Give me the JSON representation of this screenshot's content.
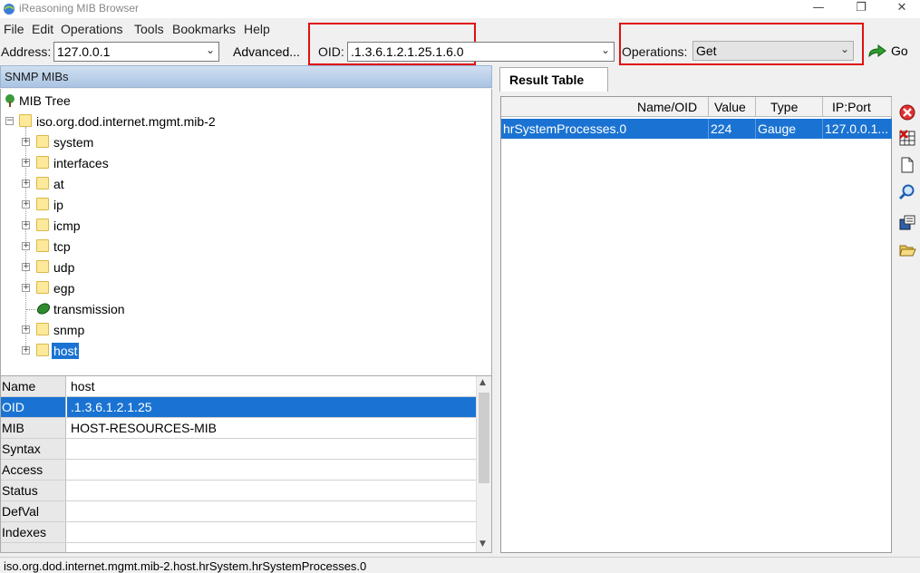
{
  "window": {
    "title": "iReasoning MIB Browser",
    "minimize": "—",
    "restore": "❐",
    "close": "✕"
  },
  "menu": [
    "File",
    "Edit",
    "Operations",
    "Tools",
    "Bookmarks",
    "Help"
  ],
  "toolbar": {
    "address_label": "Address:",
    "address_value": "127.0.0.1",
    "advanced_label": "Advanced...",
    "oid_label": "OID:",
    "oid_value": ".1.3.6.1.2.1.25.1.6.0",
    "operations_label": "Operations:",
    "operations_value": "Get",
    "go_label": "Go"
  },
  "left": {
    "header": "SNMP MIBs",
    "tree": {
      "root": "MIB Tree",
      "mib2": "iso.org.dod.internet.mgmt.mib-2",
      "children": [
        "system",
        "interfaces",
        "at",
        "ip",
        "icmp",
        "tcp",
        "udp",
        "egp",
        "transmission",
        "snmp",
        "host"
      ],
      "selected": "host"
    },
    "props": {
      "header": {
        "key": "Name",
        "value": "host"
      },
      "rows": [
        {
          "key": "OID",
          "value": ".1.3.6.1.2.1.25"
        },
        {
          "key": "MIB",
          "value": "HOST-RESOURCES-MIB"
        },
        {
          "key": "Syntax",
          "value": ""
        },
        {
          "key": "Access",
          "value": ""
        },
        {
          "key": "Status",
          "value": ""
        },
        {
          "key": "DefVal",
          "value": ""
        },
        {
          "key": "Indexes",
          "value": ""
        }
      ]
    }
  },
  "right": {
    "tab": "Result Table",
    "columns": [
      "Name/OID",
      "Value",
      "Type",
      "IP:Port"
    ],
    "rows": [
      {
        "name": "hrSystemProcesses.0",
        "value": "224",
        "type": "Gauge",
        "ipport": "127.0.0.1..."
      }
    ],
    "tools": [
      "delete-icon",
      "table-delete-icon",
      "document-icon",
      "search-icon",
      "export-icon",
      "open-folder-icon"
    ]
  },
  "status": "iso.org.dod.internet.mgmt.mib-2.host.hrSystem.hrSystemProcesses.0",
  "colors": {
    "selection": "#1a73d2",
    "highlight_box": "#e01010",
    "header": "#aac3e3"
  }
}
